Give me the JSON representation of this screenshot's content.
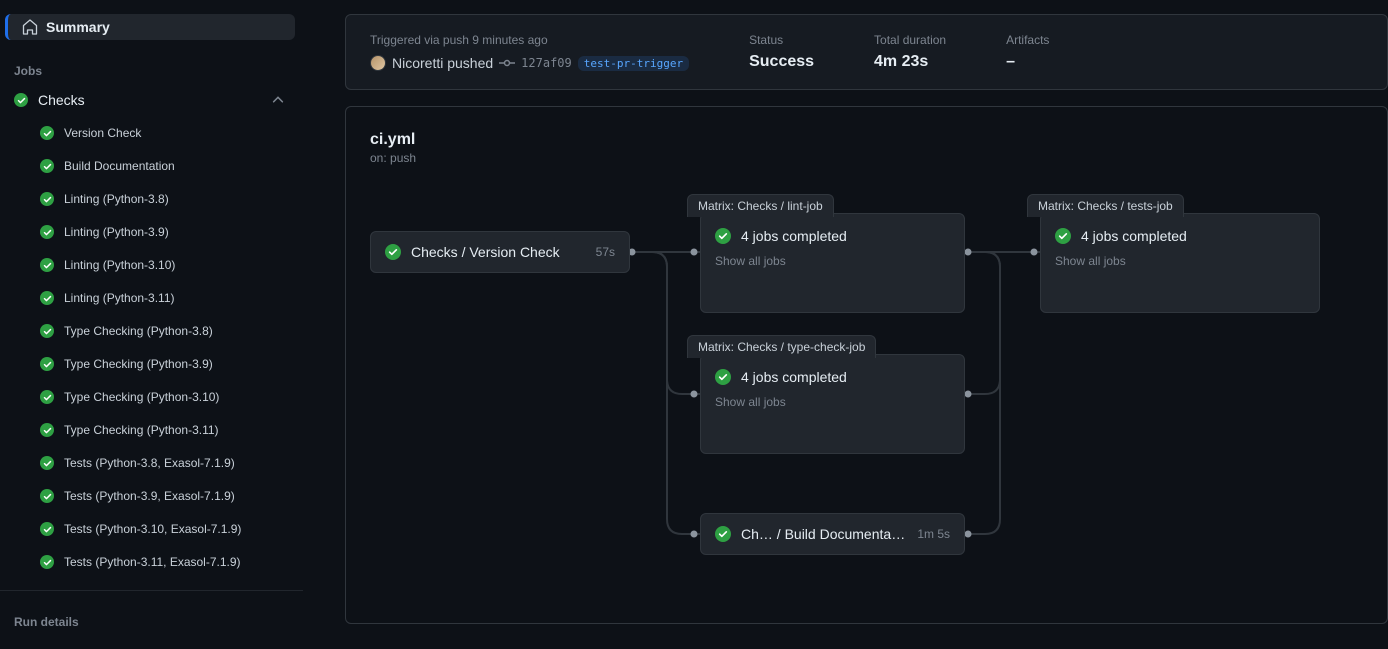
{
  "sidebar": {
    "summary_label": "Summary",
    "jobs_label": "Jobs",
    "run_details_label": "Run details",
    "group": {
      "name": "Checks"
    },
    "items": [
      {
        "label": "Version Check"
      },
      {
        "label": "Build Documentation"
      },
      {
        "label": "Linting (Python-3.8)"
      },
      {
        "label": "Linting (Python-3.9)"
      },
      {
        "label": "Linting (Python-3.10)"
      },
      {
        "label": "Linting (Python-3.11)"
      },
      {
        "label": "Type Checking (Python-3.8)"
      },
      {
        "label": "Type Checking (Python-3.9)"
      },
      {
        "label": "Type Checking (Python-3.10)"
      },
      {
        "label": "Type Checking (Python-3.11)"
      },
      {
        "label": "Tests (Python-3.8, Exasol-7.1.9)"
      },
      {
        "label": "Tests (Python-3.9, Exasol-7.1.9)"
      },
      {
        "label": "Tests (Python-3.10, Exasol-7.1.9)"
      },
      {
        "label": "Tests (Python-3.11, Exasol-7.1.9)"
      }
    ]
  },
  "header": {
    "trigger_text": "Triggered via push 9 minutes ago",
    "actor": "Nicoretti pushed",
    "sha": "127af09",
    "branch": "test-pr-trigger",
    "status_label": "Status",
    "status_value": "Success",
    "duration_label": "Total duration",
    "duration_value": "4m 23s",
    "artifacts_label": "Artifacts",
    "artifacts_value": "–"
  },
  "workflow": {
    "file": "ci.yml",
    "event": "on: push"
  },
  "graph": {
    "node_version": {
      "label": "Checks / Version Check",
      "time": "57s"
    },
    "matrix_lint": {
      "tab": "Matrix: Checks / lint-job",
      "summary": "4 jobs completed",
      "show": "Show all jobs"
    },
    "matrix_type": {
      "tab": "Matrix: Checks / type-check-job",
      "summary": "4 jobs completed",
      "show": "Show all jobs"
    },
    "matrix_tests": {
      "tab": "Matrix: Checks / tests-job",
      "summary": "4 jobs completed",
      "show": "Show all jobs"
    },
    "node_docs": {
      "label": "Ch… / Build Documentation",
      "time": "1m 5s"
    }
  }
}
